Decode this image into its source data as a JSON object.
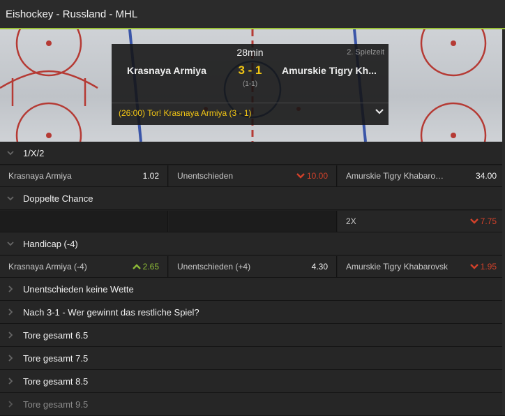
{
  "header": {
    "title": "Eishockey - Russland - MHL"
  },
  "scoreboard": {
    "time": "28min",
    "period": "2. Spielzeit",
    "home": "Krasnaya Armiya",
    "away": "Amurskie Tigry Kh...",
    "score": "3 - 1",
    "half_score": "(1-1)",
    "event": "(26:00) Tor! Krasnaya Armiya (3 - 1)"
  },
  "markets": {
    "m1x2": {
      "title": "1/X/2",
      "c1": {
        "label": "Krasnaya Armiya",
        "odd": "1.02"
      },
      "c2": {
        "label": "Unentschieden",
        "odd": "10.00",
        "trend": "down"
      },
      "c3": {
        "label": "Amurskie Tigry Khabaro…",
        "odd": "34.00"
      }
    },
    "dc": {
      "title": "Doppelte Chance",
      "c3": {
        "label": "2X",
        "odd": "7.75",
        "trend": "down"
      }
    },
    "handicap": {
      "title": "Handicap (-4)",
      "c1": {
        "label": "Krasnaya Armiya (-4)",
        "odd": "2.65",
        "trend": "up"
      },
      "c2": {
        "label": "Unentschieden (+4)",
        "odd": "4.30"
      },
      "c3": {
        "label": "Amurskie Tigry Khabarovsk",
        "odd": "1.95",
        "trend": "down"
      }
    },
    "collapsed": [
      "Unentschieden keine Wette",
      "Nach 3-1 - Wer gewinnt das restliche Spiel?",
      "Tore gesamt 6.5",
      "Tore gesamt 7.5",
      "Tore gesamt 8.5",
      "Tore gesamt 9.5"
    ]
  },
  "colors": {
    "accent": "#9cc33a",
    "score": "#f3c614",
    "down": "#d2412a",
    "up": "#8dbb37"
  }
}
